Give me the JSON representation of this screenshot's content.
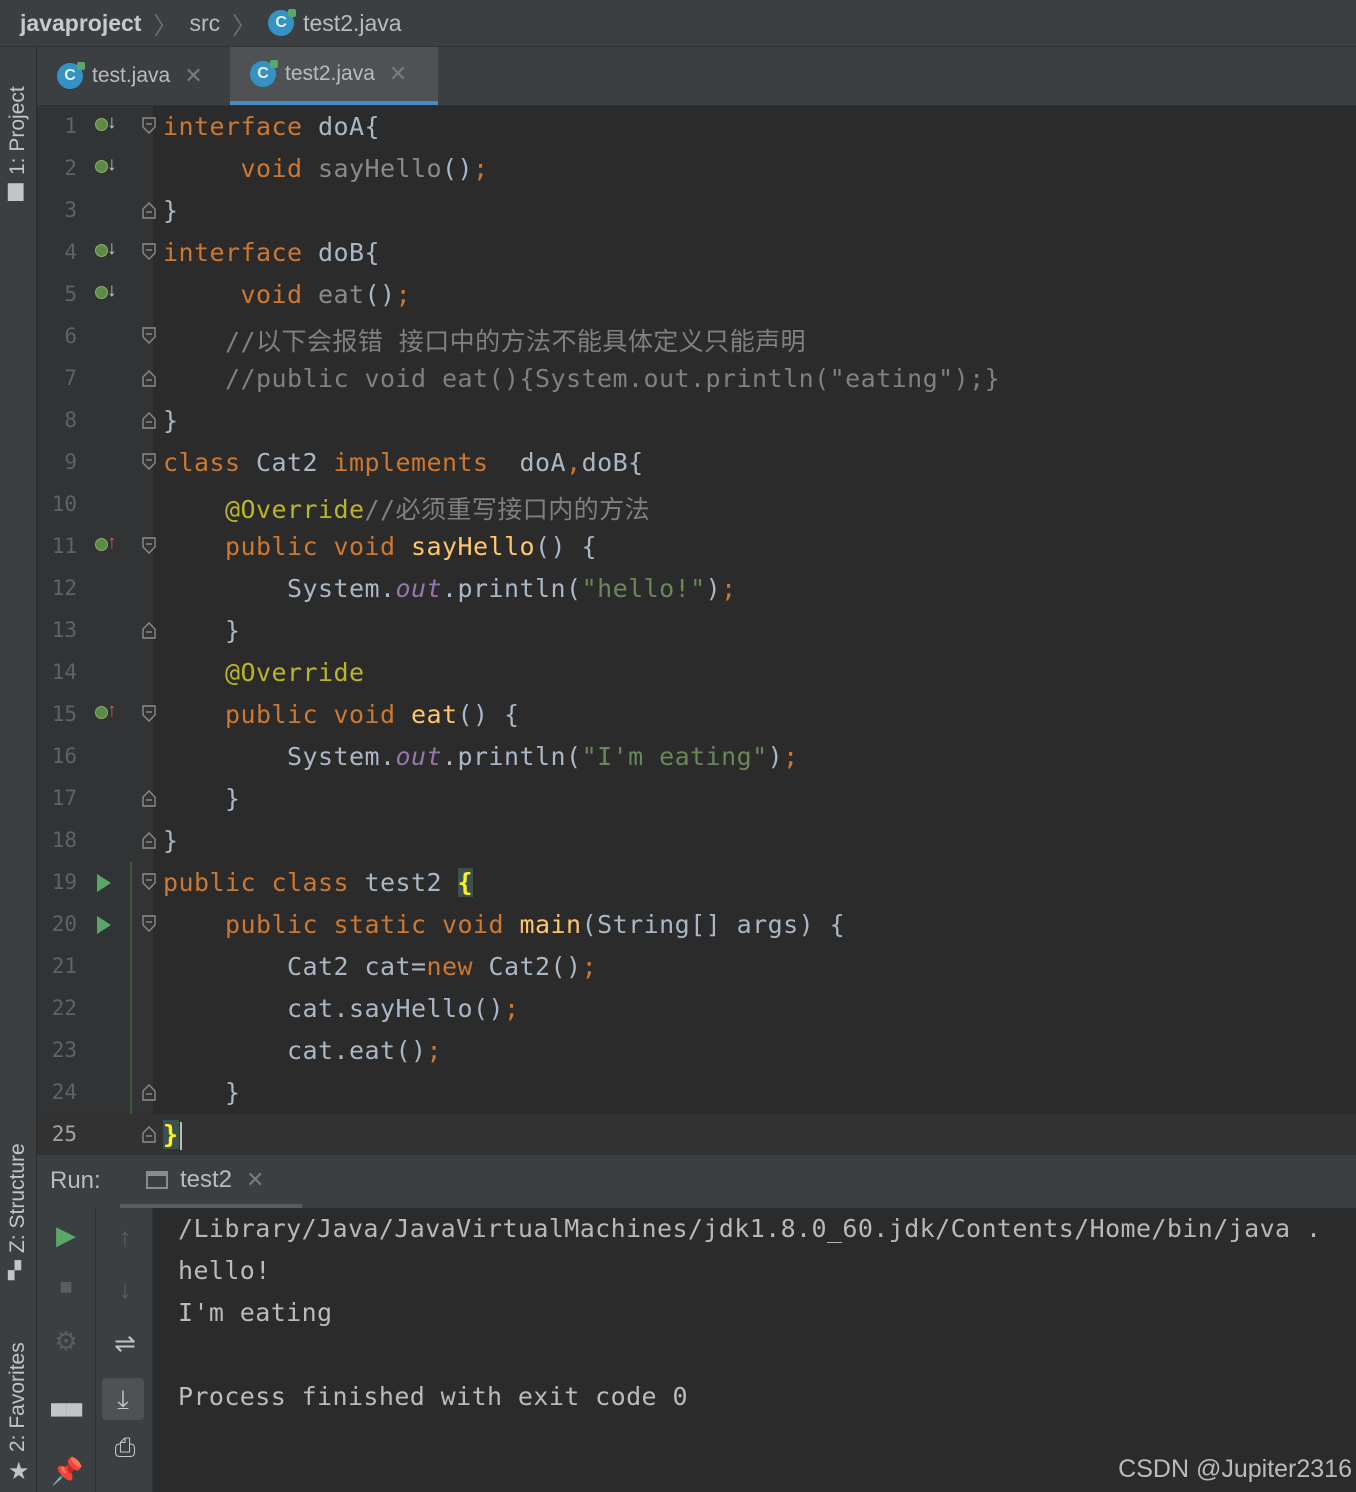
{
  "breadcrumb": {
    "project": "javaproject",
    "folder": "src",
    "file": "test2.java"
  },
  "left_strip": {
    "project_label": "1: Project",
    "structure_label": "Z: Structure",
    "favorites_label": "2: Favorites"
  },
  "tabs": [
    {
      "label": "test.java",
      "active": false
    },
    {
      "label": "test2.java",
      "active": true
    }
  ],
  "editor": {
    "current_line": 25,
    "lines": [
      {
        "n": "1",
        "gutter": "implemented-down"
      },
      {
        "n": "2",
        "gutter": "implemented-down"
      },
      {
        "n": "3",
        "gutter": ""
      },
      {
        "n": "4",
        "gutter": "implemented-down"
      },
      {
        "n": "5",
        "gutter": "implemented-down"
      },
      {
        "n": "6",
        "gutter": ""
      },
      {
        "n": "7",
        "gutter": ""
      },
      {
        "n": "8",
        "gutter": ""
      },
      {
        "n": "9",
        "gutter": ""
      },
      {
        "n": "10",
        "gutter": ""
      },
      {
        "n": "11",
        "gutter": "implements-up"
      },
      {
        "n": "12",
        "gutter": ""
      },
      {
        "n": "13",
        "gutter": ""
      },
      {
        "n": "14",
        "gutter": ""
      },
      {
        "n": "15",
        "gutter": "implements-up"
      },
      {
        "n": "16",
        "gutter": ""
      },
      {
        "n": "17",
        "gutter": ""
      },
      {
        "n": "18",
        "gutter": ""
      },
      {
        "n": "19",
        "gutter": "run"
      },
      {
        "n": "20",
        "gutter": "run"
      },
      {
        "n": "21",
        "gutter": ""
      },
      {
        "n": "22",
        "gutter": ""
      },
      {
        "n": "23",
        "gutter": ""
      },
      {
        "n": "24",
        "gutter": ""
      },
      {
        "n": "25",
        "gutter": ""
      }
    ],
    "code": {
      "l1": {
        "kw": "interface",
        "rest": " doA{"
      },
      "l2": {
        "kw": "void",
        "name": " sayHello",
        "rest": "()",
        "semi": ";"
      },
      "l3": {
        "text": "}"
      },
      "l4": {
        "kw": "interface",
        "rest": " doB{"
      },
      "l5": {
        "kw": "void",
        "name": " eat",
        "rest": "()",
        "semi": ";"
      },
      "l6": {
        "comment": "//以下会报错 接口中的方法不能具体定义只能声明"
      },
      "l7": {
        "comment": "//public void eat(){System.out.println(\"eating\");}"
      },
      "l8": {
        "text": "}"
      },
      "l9": {
        "kw1": "class",
        "name": " Cat2 ",
        "kw2": "implements",
        "rest1": "  doA",
        "comma": ",",
        "rest2": "doB{"
      },
      "l10": {
        "annot": "@Override",
        "comment": "//必须重写接口内的方法"
      },
      "l11": {
        "kw": "public void ",
        "fn": "sayHello",
        "rest": "() {"
      },
      "l12": {
        "obj": "System.",
        "field": "out",
        "call": ".println(",
        "str": "\"hello!\"",
        "close": ")",
        "semi": ";"
      },
      "l13": {
        "text": "}"
      },
      "l14": {
        "annot": "@Override"
      },
      "l15": {
        "kw": "public void ",
        "fn": "eat",
        "rest": "() {"
      },
      "l16": {
        "obj": "System.",
        "field": "out",
        "call": ".println(",
        "str": "\"I'm eating\"",
        "close": ")",
        "semi": ";"
      },
      "l17": {
        "text": "}"
      },
      "l18": {
        "text": "}"
      },
      "l19": {
        "kw": "public class ",
        "name": "test2 ",
        "brace": "{"
      },
      "l20": {
        "kw": "public static void ",
        "fn": "main",
        "rest": "(String[] args) {"
      },
      "l21": {
        "a": "Cat2 cat=",
        "kw": "new",
        "b": " Cat2()",
        "semi": ";"
      },
      "l22": {
        "a": "cat.sayHello()",
        "semi": ";"
      },
      "l23": {
        "a": "cat.eat()",
        "semi": ";"
      },
      "l24": {
        "text": "}"
      },
      "l25": {
        "brace": "}"
      }
    }
  },
  "run_panel": {
    "label": "Run:",
    "tab": "test2",
    "output": [
      "/Library/Java/JavaVirtualMachines/jdk1.8.0_60.jdk/Contents/Home/bin/java .",
      "hello!",
      "I'm eating",
      "",
      "Process finished with exit code 0"
    ]
  },
  "watermark": "CSDN @Jupiter2316"
}
